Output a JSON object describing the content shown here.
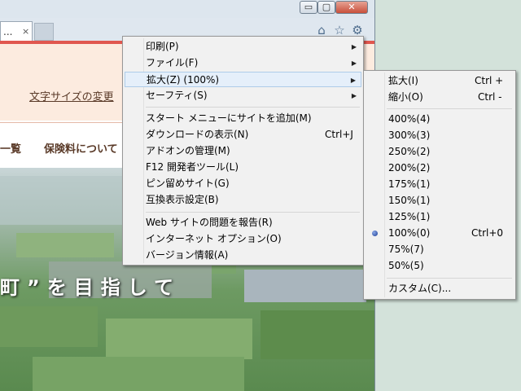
{
  "tab": {
    "title": "...",
    "close": "×"
  },
  "window": {
    "min": "▭",
    "max": "▢",
    "close": "✕"
  },
  "page": {
    "text_size_link": "文字サイズの変更",
    "nav_left": "一覧",
    "nav_right": "保険料について",
    "slogan": "町”を目指して"
  },
  "tools_menu": {
    "items": [
      {
        "label": "印刷(P)",
        "arrow": "▶"
      },
      {
        "label": "ファイル(F)",
        "arrow": "▶"
      },
      {
        "label": "拡大(Z) (100%)",
        "arrow": "▶"
      },
      {
        "label": "セーフティ(S)",
        "arrow": "▶"
      },
      {
        "label": "スタート メニューにサイトを追加(M)"
      },
      {
        "label": "ダウンロードの表示(N)",
        "shortcut": "Ctrl+J"
      },
      {
        "label": "アドオンの管理(M)"
      },
      {
        "label": "F12 開発者ツール(L)"
      },
      {
        "label": "ピン留めサイト(G)"
      },
      {
        "label": "互換表示設定(B)"
      },
      {
        "label": "Web サイトの問題を報告(R)"
      },
      {
        "label": "インターネット オプション(O)"
      },
      {
        "label": "バージョン情報(A)"
      }
    ]
  },
  "zoom_menu": {
    "items": [
      {
        "label": "拡大(I)",
        "shortcut": "Ctrl +"
      },
      {
        "label": "縮小(O)",
        "shortcut": "Ctrl -"
      },
      {
        "label": "400%(4)"
      },
      {
        "label": "300%(3)"
      },
      {
        "label": "250%(2)"
      },
      {
        "label": "200%(2)"
      },
      {
        "label": "175%(1)"
      },
      {
        "label": "150%(1)"
      },
      {
        "label": "125%(1)"
      },
      {
        "label": "100%(0)",
        "shortcut": "Ctrl+0",
        "selected": true
      },
      {
        "label": "75%(7)"
      },
      {
        "label": "50%(5)"
      },
      {
        "label": "カスタム(C)..."
      }
    ]
  }
}
